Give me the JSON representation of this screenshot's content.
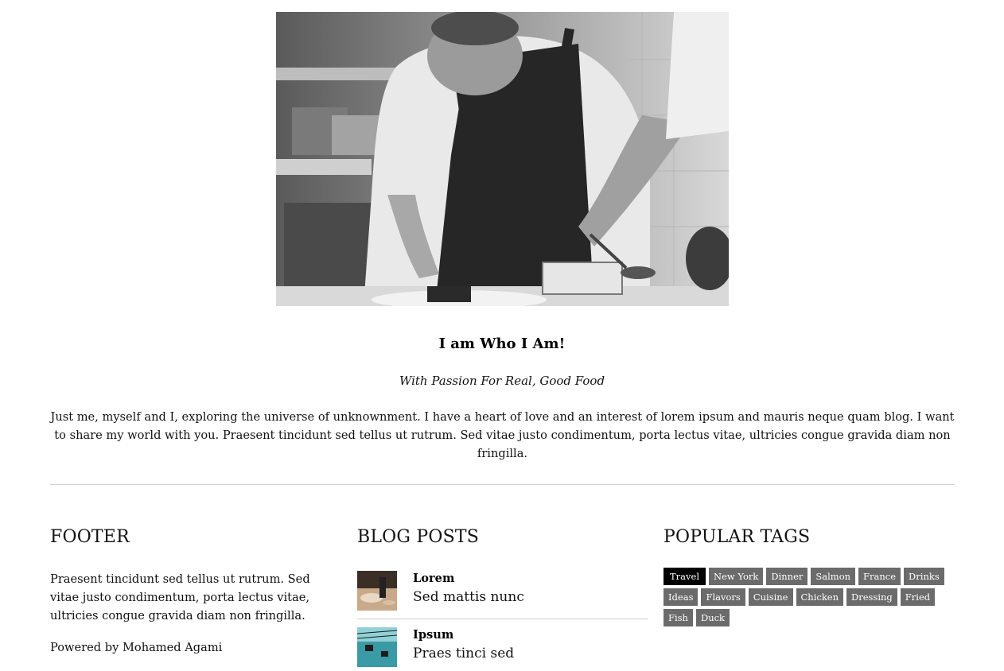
{
  "hero": {
    "alt": "Chef plating food in a kitchen (black and white photo)"
  },
  "about": {
    "title": "I am Who I Am!",
    "subtitle": "With Passion For Real, Good Food",
    "bio": "Just me, myself and I, exploring the universe of unknownment. I have a heart of love and an interest of lorem ipsum and mauris neque quam blog. I want to share my world with you. Praesent tincidunt sed tellus ut rutrum. Sed vitae justo condimentum, porta lectus vitae, ultricies congue gravida diam non fringilla."
  },
  "footer": {
    "heading": "FOOTER",
    "text": "Praesent tincidunt sed tellus ut rutrum. Sed vitae justo condimentum, porta lectus vitae, ultricies congue gravida diam non fringilla.",
    "powered": "Powered by Mohamed Agami"
  },
  "blog_posts": {
    "heading": "BLOG POSTS",
    "items": [
      {
        "title": "Lorem",
        "excerpt": "Sed mattis nunc"
      },
      {
        "title": "Ipsum",
        "excerpt": "Praes tinci sed"
      }
    ]
  },
  "popular_tags": {
    "heading": "POPULAR TAGS",
    "active_color": "#000000",
    "tag_color": "#6b6b6b",
    "tags": [
      "Travel",
      "New York",
      "Dinner",
      "Salmon",
      "France",
      "Drinks",
      "Ideas",
      "Flavors",
      "Cuisine",
      "Chicken",
      "Dressing",
      "Fried",
      "Fish",
      "Duck"
    ]
  }
}
